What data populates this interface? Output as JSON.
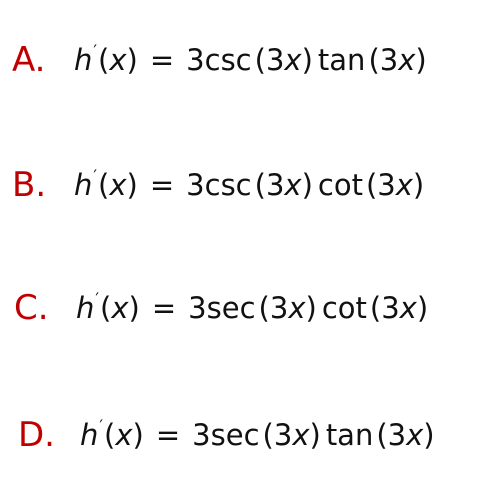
{
  "options": [
    {
      "letter": "A.",
      "func": "h",
      "prime": "′",
      "var": "x",
      "lhs_open": "(",
      "lhs_close": ")",
      "eq": "=",
      "coeff": "3",
      "fn1": "csc",
      "arg1_coeff": "3",
      "arg1_var": "x",
      "fn2": "tan",
      "arg2_coeff": "3",
      "arg2_var": "x"
    },
    {
      "letter": "B.",
      "func": "h",
      "prime": "′",
      "var": "x",
      "lhs_open": "(",
      "lhs_close": ")",
      "eq": "=",
      "coeff": "3",
      "fn1": "csc",
      "arg1_coeff": "3",
      "arg1_var": "x",
      "fn2": "cot",
      "arg2_coeff": "3",
      "arg2_var": "x"
    },
    {
      "letter": "C.",
      "func": "h",
      "prime": "′",
      "var": "x",
      "lhs_open": "(",
      "lhs_close": ")",
      "eq": "=",
      "coeff": "3",
      "fn1": "sec",
      "arg1_coeff": "3",
      "arg1_var": "x",
      "fn2": "cot",
      "arg2_coeff": "3",
      "arg2_var": "x"
    },
    {
      "letter": "D.",
      "func": "h",
      "prime": "′",
      "var": "x",
      "lhs_open": "(",
      "lhs_close": ")",
      "eq": "=",
      "coeff": "3",
      "fn1": "sec",
      "arg1_coeff": "3",
      "arg1_var": "x",
      "fn2": "tan",
      "arg2_coeff": "3",
      "arg2_var": "x"
    }
  ],
  "colors": {
    "letter": "#c00000",
    "text": "#111111",
    "background": "#ffffff"
  }
}
